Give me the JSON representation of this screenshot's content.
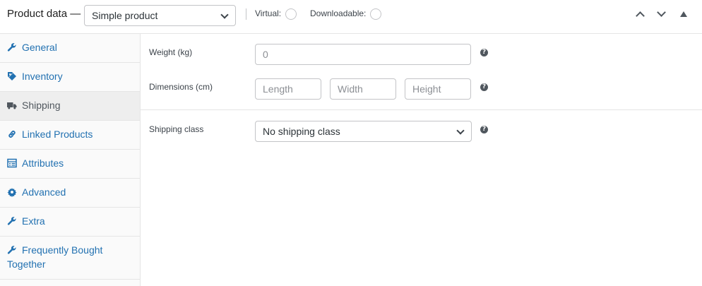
{
  "header": {
    "title": "Product data —",
    "product_type": "Simple product",
    "virtual_label": "Virtual:",
    "downloadable_label": "Downloadable:"
  },
  "sidebar": {
    "items": [
      {
        "label": "General",
        "icon": "wrench-icon",
        "active": false
      },
      {
        "label": "Inventory",
        "icon": "tag-icon",
        "active": false
      },
      {
        "label": "Shipping",
        "icon": "truck-icon",
        "active": true
      },
      {
        "label": "Linked Products",
        "icon": "link-icon",
        "active": false
      },
      {
        "label": "Attributes",
        "icon": "list-table-icon",
        "active": false
      },
      {
        "label": "Advanced",
        "icon": "gear-icon",
        "active": false
      },
      {
        "label": "Extra",
        "icon": "wrench-icon",
        "active": false
      },
      {
        "label": "Frequently Bought Together",
        "icon": "wrench-icon",
        "active": false
      }
    ]
  },
  "shipping": {
    "weight_label": "Weight (kg)",
    "weight_placeholder": "0",
    "dimensions_label": "Dimensions (cm)",
    "length_placeholder": "Length",
    "width_placeholder": "Width",
    "height_placeholder": "Height",
    "class_label": "Shipping class",
    "class_value": "No shipping class",
    "help_glyph": "?"
  },
  "colors": {
    "link": "#2271b1",
    "active_tab_bg": "#eeeeee",
    "border": "#c3c4c7",
    "icon": "#50575e"
  }
}
